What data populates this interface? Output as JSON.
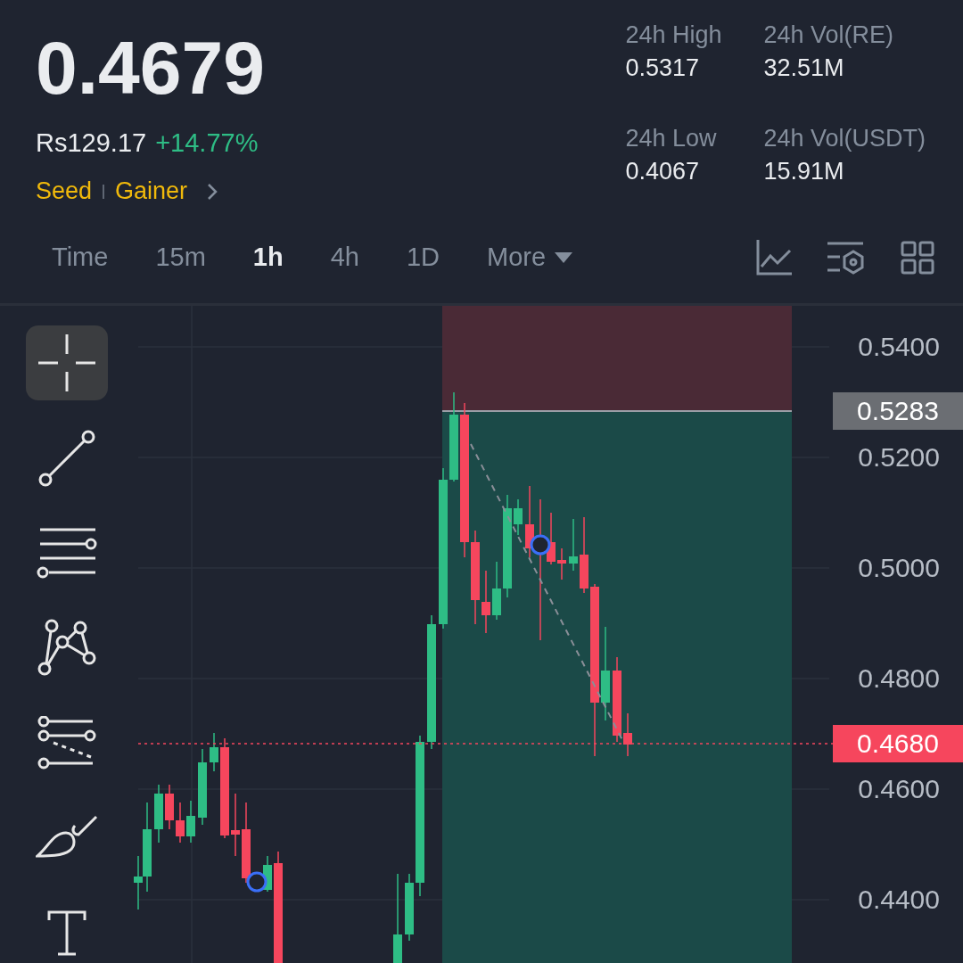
{
  "ticker": {
    "price": "0.4679",
    "fiat": "Rs129.17",
    "change": "+14.77%",
    "tags": [
      "Seed",
      "Gainer"
    ]
  },
  "stats": [
    {
      "label": "24h High",
      "value": "0.5317"
    },
    {
      "label": "24h Vol(RE)",
      "value": "32.51M"
    },
    {
      "label": "24h Low",
      "value": "0.4067"
    },
    {
      "label": "24h Vol(USDT)",
      "value": "15.91M"
    }
  ],
  "intervals": [
    {
      "label": "Time",
      "selected": false,
      "kind": "option"
    },
    {
      "label": "15m",
      "selected": false,
      "kind": "option"
    },
    {
      "label": "1h",
      "selected": true,
      "kind": "option"
    },
    {
      "label": "4h",
      "selected": false,
      "kind": "option"
    },
    {
      "label": "1D",
      "selected": false,
      "kind": "option"
    },
    {
      "label": "More",
      "selected": false,
      "kind": "menu"
    }
  ],
  "tools": [
    {
      "kind": "crosshair",
      "selected": true
    },
    {
      "kind": "trend-line",
      "selected": false
    },
    {
      "kind": "parallel-lines",
      "selected": false
    },
    {
      "kind": "pattern",
      "selected": false
    },
    {
      "kind": "fib-lines",
      "selected": false
    },
    {
      "kind": "brush",
      "selected": false
    },
    {
      "kind": "text",
      "selected": false
    }
  ],
  "chart": {
    "price_axis": [
      "0.5400",
      "0.5200",
      "0.5000",
      "0.4800",
      "0.4600",
      "0.4400"
    ],
    "range_tag": "0.5283",
    "last_price_tag": "0.4680"
  }
}
